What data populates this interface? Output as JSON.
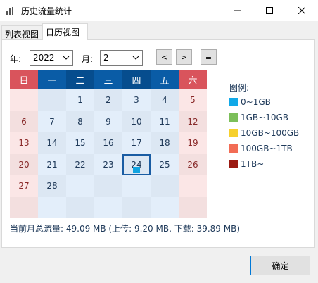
{
  "window": {
    "title": "历史流量统计"
  },
  "tabs": [
    {
      "label": "列表视图"
    },
    {
      "label": "日历视图"
    }
  ],
  "controls": {
    "year_label": "年:",
    "year_value": "2022",
    "month_label": "月:",
    "month_value": "2",
    "prev_label": "<",
    "next_label": ">",
    "menu_label": "≡"
  },
  "calendar": {
    "weekdays": [
      "日",
      "一",
      "二",
      "三",
      "四",
      "五",
      "六"
    ],
    "rows": [
      [
        "",
        "",
        "1",
        "2",
        "3",
        "4",
        "5"
      ],
      [
        "6",
        "7",
        "8",
        "9",
        "10",
        "11",
        "12"
      ],
      [
        "13",
        "14",
        "15",
        "16",
        "17",
        "18",
        "19"
      ],
      [
        "20",
        "21",
        "22",
        "23",
        "24",
        "25",
        "26"
      ],
      [
        "27",
        "28",
        "",
        "",
        "",
        "",
        ""
      ],
      [
        "",
        "",
        "",
        "",
        "",
        "",
        ""
      ]
    ],
    "selected_day": "24"
  },
  "legend": {
    "title": "图例:",
    "items": [
      {
        "label": "0~1GB",
        "color": "#11a9e8"
      },
      {
        "label": "1GB~10GB",
        "color": "#7cbf5a"
      },
      {
        "label": "10GB~100GB",
        "color": "#f6d02d"
      },
      {
        "label": "100GB~1TB",
        "color": "#f26c55"
      },
      {
        "label": "1TB~",
        "color": "#9b1a12"
      }
    ]
  },
  "summary": "当前月总流量: 49.09 MB (上传: 9.20 MB, 下载: 39.89 MB)",
  "ok_label": "确定"
}
